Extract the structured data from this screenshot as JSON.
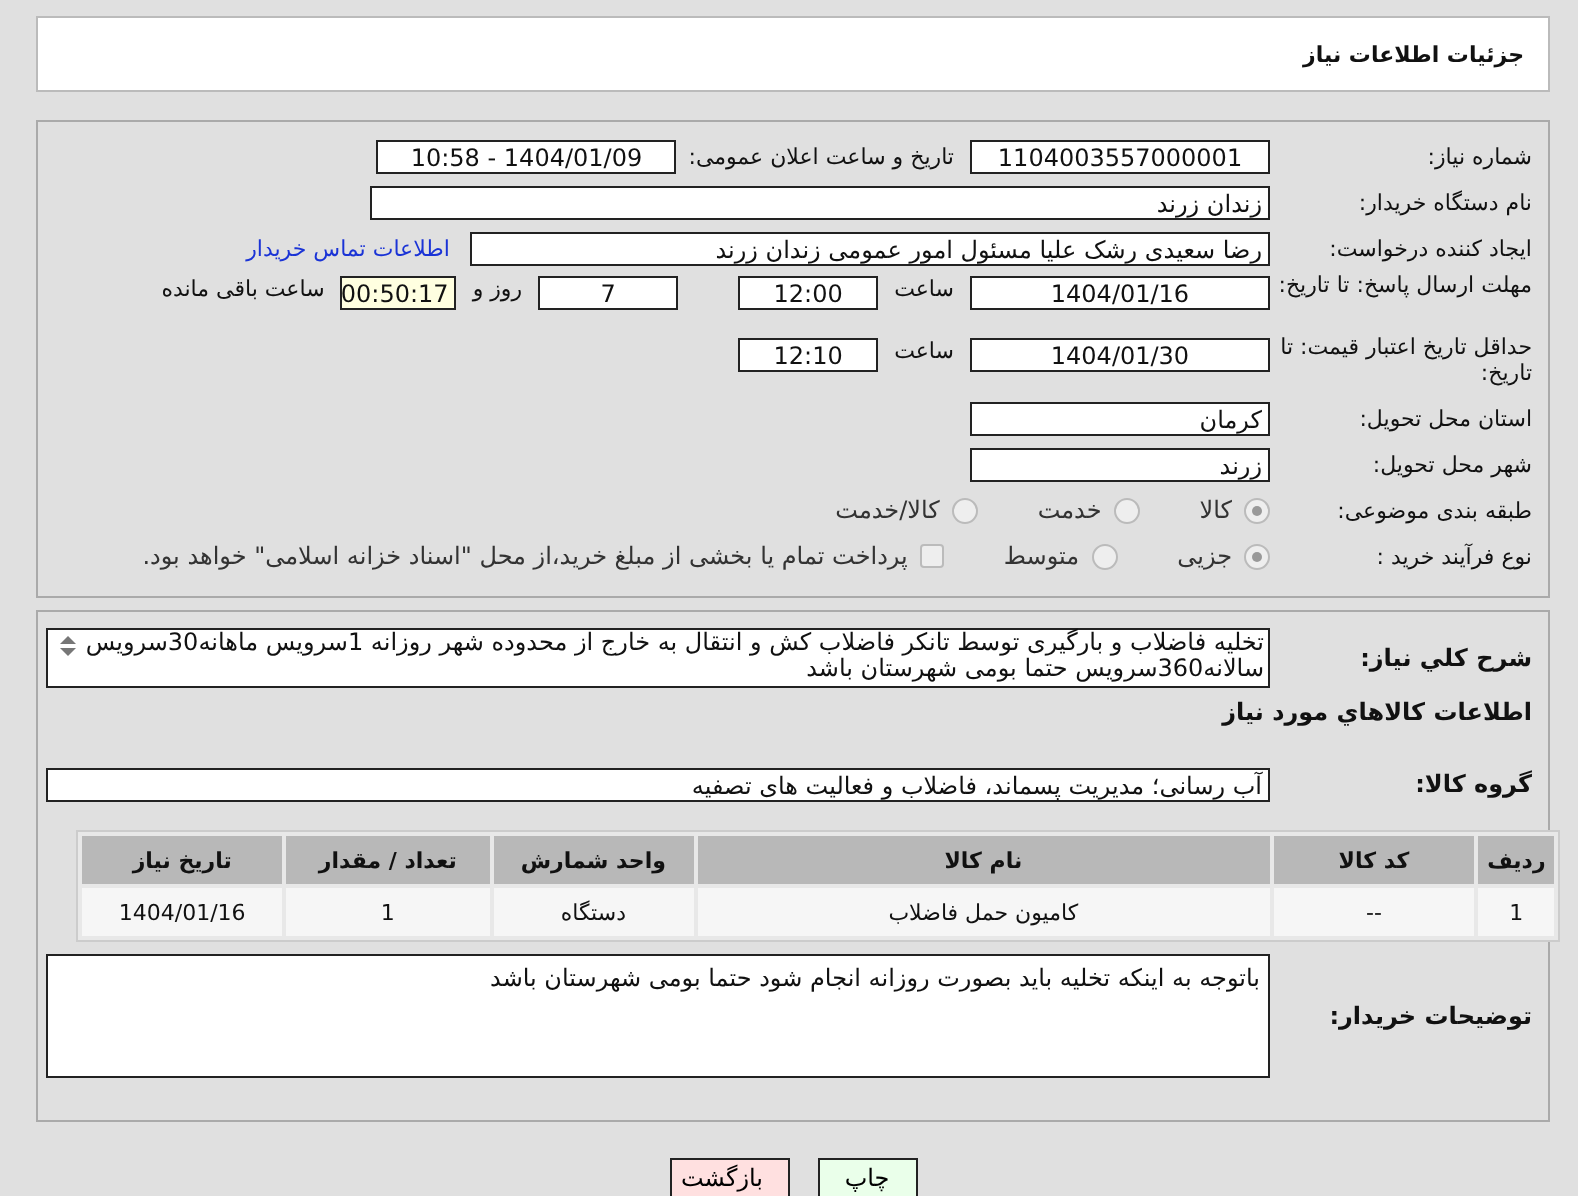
{
  "header": {
    "title": "جزئیات اطلاعات نیاز"
  },
  "need_number": {
    "label": "شماره نیاز:",
    "value": "1104003557000001"
  },
  "announce": {
    "label": "تاریخ و ساعت اعلان عمومی:",
    "value": "1404/01/09 - 10:58"
  },
  "buyer": {
    "label": "نام دستگاه خریدار:",
    "value": "زندان زرند"
  },
  "requester": {
    "label": "ایجاد کننده درخواست:",
    "value": "رضا سعیدی رشک علیا مسئول امور عمومی زندان زرند",
    "link": "اطلاعات تماس خریدار"
  },
  "reply_deadline": {
    "label": "مهلت ارسال پاسخ: تا تاریخ:",
    "date": "1404/01/16",
    "time_label": "ساعت",
    "time": "12:00",
    "days": "7",
    "days_label": "روز و",
    "remaining": "00:50:17",
    "remaining_label": "ساعت باقی مانده"
  },
  "price_validity": {
    "label": "حداقل تاریخ اعتبار قیمت: تا تاریخ:",
    "date": "1404/01/30",
    "time_label": "ساعت",
    "time": "12:10"
  },
  "province": {
    "label": "استان محل تحویل:",
    "value": "کرمان"
  },
  "city": {
    "label": "شهر محل تحویل:",
    "value": "زرند"
  },
  "category": {
    "label": "طبقه بندی موضوعی:",
    "options": [
      {
        "label": "کالا",
        "selected": true
      },
      {
        "label": "خدمت",
        "selected": false
      },
      {
        "label": "کالا/خدمت",
        "selected": false
      }
    ]
  },
  "purchase_type": {
    "label": "نوع فرآیند خرید :",
    "options": [
      {
        "label": "جزیی",
        "selected": true
      },
      {
        "label": "متوسط",
        "selected": false
      }
    ],
    "payment": {
      "label": "پرداخت تمام یا بخشی از مبلغ خرید،از محل \"اسناد خزانه اسلامی\" خواهد بود.",
      "checked": false
    }
  },
  "description": {
    "label": "شرح کلي نياز:",
    "value": "تخلیه فاضلاب و بارگیری توسط تانکر فاضلاب کش و انتقال به خارج از محدوده شهر روزانه 1سرویس ماهانه30سرویس سالانه360سرویس حتما بومی شهرستان باشد"
  },
  "goods_heading": "اطلاعات کالاهاي مورد نياز",
  "goods_group": {
    "label": "گروه کالا:",
    "value": "آب رسانی؛ مدیریت پسماند، فاضلاب و فعالیت های تصفیه"
  },
  "table": {
    "columns": [
      "ردیف",
      "کد کالا",
      "نام کالا",
      "واحد شمارش",
      "تعداد / مقدار",
      "تاریخ نیاز"
    ],
    "rows": [
      [
        "1",
        "--",
        "کامیون حمل فاضلاب",
        "دستگاه",
        "1",
        "1404/01/16"
      ]
    ]
  },
  "buyer_notes": {
    "label": "توضیحات خریدار:",
    "value": "باتوجه به اینکه تخلیه باید بصورت روزانه انجام شود حتما بومی شهرستان باشد"
  },
  "buttons": [
    {
      "label": "چاپ",
      "kind": "print"
    },
    {
      "label": "بازگشت",
      "kind": "back"
    }
  ]
}
